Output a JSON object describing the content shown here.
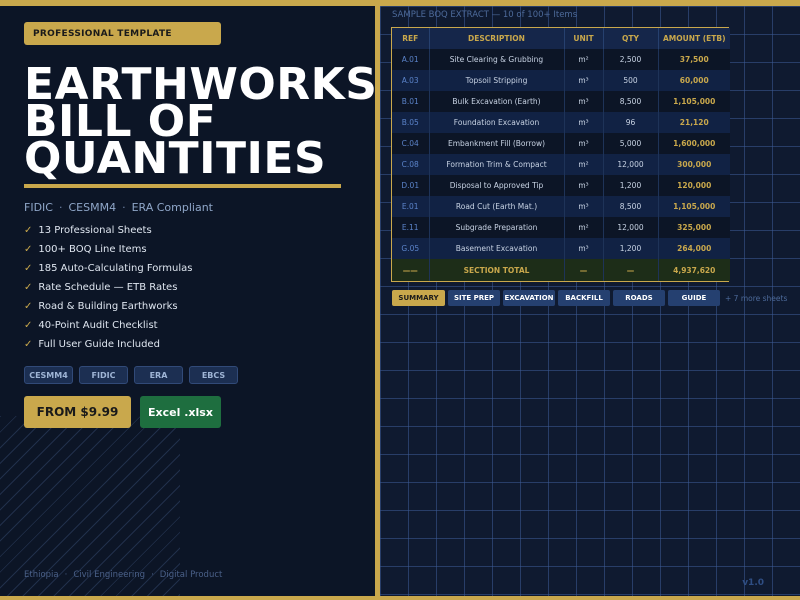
{
  "header": {
    "badge": "PROFESSIONAL TEMPLATE",
    "title_lines": [
      "EARTHWORKS",
      "BILL OF",
      "QUANTITIES"
    ],
    "subtitle": [
      "FIDIC",
      "CESMM4",
      "ERA Compliant"
    ]
  },
  "features": [
    "13 Professional Sheets",
    "100+ BOQ Line Items",
    "185 Auto-Calculating Formulas",
    "Rate Schedule — ETB Rates",
    "Road & Building Earthworks",
    "40-Point Audit Checklist",
    "Full User Guide Included"
  ],
  "tags": [
    "CESMM4",
    "FIDIC",
    "ERA",
    "EBCS"
  ],
  "cta": {
    "price": "FROM $9.99",
    "format": "Excel .xlsx"
  },
  "footer": [
    "Ethiopia",
    "Civil Engineering",
    "Digital Product"
  ],
  "preview": {
    "label": "SAMPLE BOQ EXTRACT  —  10 of 100+ Items",
    "columns": [
      "REF",
      "DESCRIPTION",
      "UNIT",
      "QTY",
      "AMOUNT (ETB)"
    ],
    "rows": [
      [
        "A.01",
        "Site Clearing & Grubbing",
        "m²",
        "2,500",
        "37,500"
      ],
      [
        "A.03",
        "Topsoil Stripping",
        "m³",
        "500",
        "60,000"
      ],
      [
        "B.01",
        "Bulk Excavation (Earth)",
        "m³",
        "8,500",
        "1,105,000"
      ],
      [
        "B.05",
        "Foundation Excavation",
        "m³",
        "96",
        "21,120"
      ],
      [
        "C.04",
        "Embankment Fill (Borrow)",
        "m³",
        "5,000",
        "1,600,000"
      ],
      [
        "C.08",
        "Formation Trim & Compact",
        "m²",
        "12,000",
        "300,000"
      ],
      [
        "D.01",
        "Disposal to Approved Tip",
        "m³",
        "1,200",
        "120,000"
      ],
      [
        "E.01",
        "Road Cut (Earth Mat.)",
        "m³",
        "8,500",
        "1,105,000"
      ],
      [
        "E.11",
        "Subgrade Preparation",
        "m²",
        "12,000",
        "325,000"
      ],
      [
        "G.05",
        "Basement Excavation",
        "m³",
        "1,200",
        "264,000"
      ]
    ],
    "total": [
      "——",
      "SECTION TOTAL",
      "—",
      "—",
      "4,937,620"
    ],
    "sheet_tabs": [
      "SUMMARY",
      "SITE PREP",
      "EXCAVATION",
      "BACKFILL",
      "ROADS",
      "GUIDE"
    ],
    "more_sheets": "+ 7 more sheets",
    "version": "v1.0"
  },
  "colors": {
    "gold": "#c9a84c",
    "navy": "#0c1526",
    "excel_green": "#1e6e3f"
  }
}
